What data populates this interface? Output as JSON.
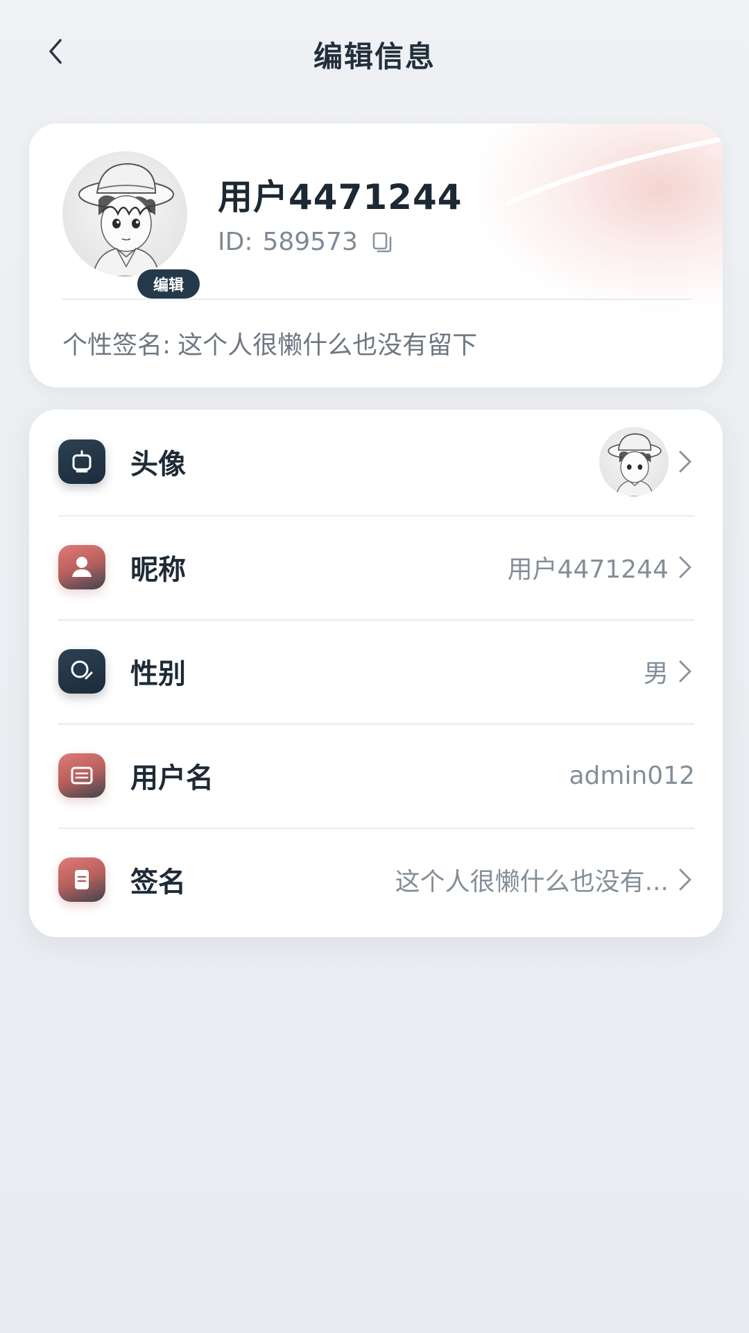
{
  "header": {
    "title": "编辑信息",
    "back_icon": "chevron-left-icon"
  },
  "profile": {
    "name": "用户4471244",
    "id_label": "ID:",
    "id_value": "589573",
    "edit_badge": "编辑",
    "bio_label": "个性签名:",
    "bio_value": "这个人很懒什么也没有留下",
    "copy_icon": "copy-icon"
  },
  "settings": {
    "rows": [
      {
        "label": "头像",
        "value": "",
        "icon": "avatar-frame-icon",
        "has_avatar": true,
        "has_chevron": true
      },
      {
        "label": "昵称",
        "value": "用户4471244",
        "icon": "person-icon",
        "has_chevron": true
      },
      {
        "label": "性别",
        "value": "男",
        "icon": "gender-icon",
        "has_chevron": true
      },
      {
        "label": "用户名",
        "value": "admin012",
        "icon": "id-card-icon",
        "has_chevron": false
      },
      {
        "label": "签名",
        "value": "这个人很懒什么也没有...",
        "icon": "document-icon",
        "has_chevron": true
      }
    ]
  },
  "colors": {
    "primary_dark": "#24394a",
    "accent_red": "#d9736f",
    "background": "#eceff2"
  }
}
